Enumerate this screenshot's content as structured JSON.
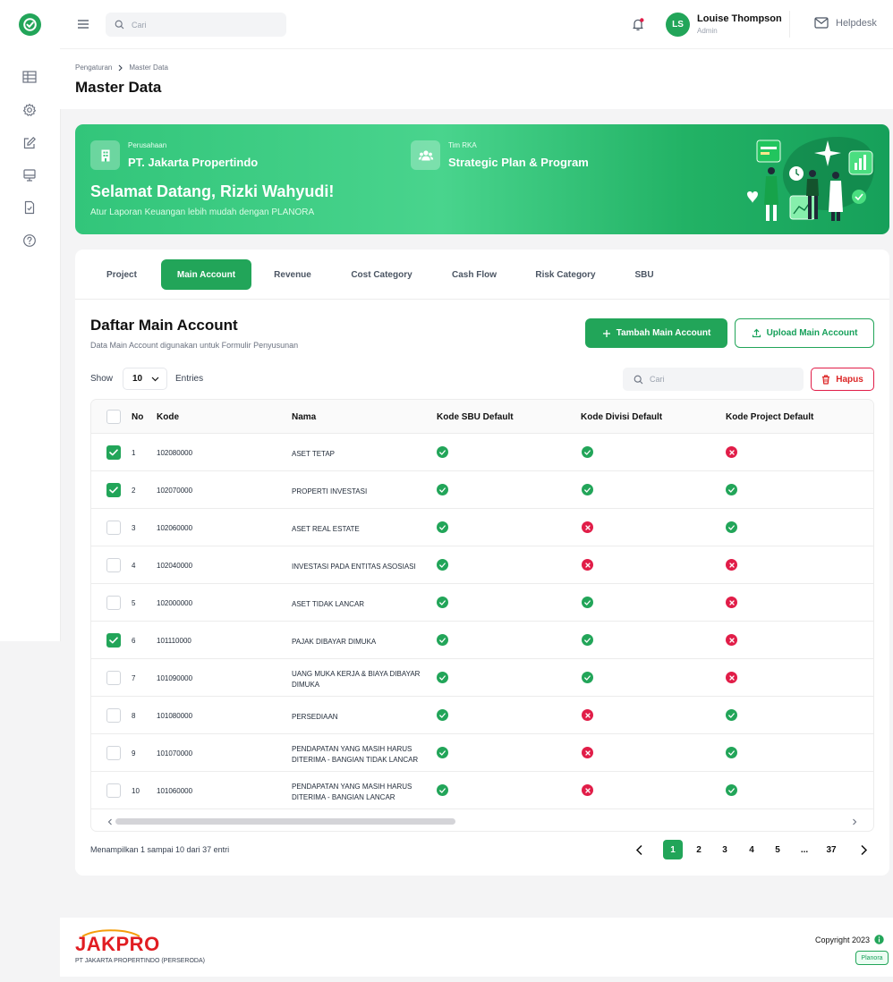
{
  "topbar": {
    "search_placeholder": "Cari",
    "user_initials": "LS",
    "user_name": "Louise Thompson",
    "user_role": "Admin",
    "helpdesk_label": "Helpdesk"
  },
  "breadcrumb": {
    "parent": "Pengaturan",
    "current": "Master Data"
  },
  "page_title": "Master Data",
  "banner": {
    "company_label": "Perusahaan",
    "company_value": "PT. Jakarta Propertindo",
    "team_label": "Tim RKA",
    "team_value": "Strategic Plan & Program",
    "welcome": "Selamat Datang, Rizki Wahyudi!",
    "subtitle": "Atur Laporan Keuangan lebih mudah dengan PLANORA"
  },
  "tabs": [
    {
      "label": "Project",
      "active": false
    },
    {
      "label": "Main Account",
      "active": true
    },
    {
      "label": "Revenue",
      "active": false
    },
    {
      "label": "Cost Category",
      "active": false
    },
    {
      "label": "Cash Flow",
      "active": false
    },
    {
      "label": "Risk Category",
      "active": false
    },
    {
      "label": "SBU",
      "active": false
    }
  ],
  "section": {
    "title": "Daftar Main Account",
    "subtitle": "Data Main Account digunakan untuk Formulir Penyusunan",
    "add_button": "Tambah Main Account",
    "upload_button": "Upload Main Account",
    "show_label": "Show",
    "entries_value": "10",
    "entries_label": "Entries",
    "search_placeholder": "Cari",
    "delete_button": "Hapus"
  },
  "table": {
    "columns": [
      "No",
      "Kode",
      "Nama",
      "Kode SBU Default",
      "Kode Divisi Default",
      "Kode Project Default"
    ],
    "rows": [
      {
        "checked": true,
        "no": "1",
        "kode": "102080000",
        "nama": [
          "ASET TETAP"
        ],
        "sbu": true,
        "divisi": true,
        "project": false
      },
      {
        "checked": true,
        "no": "2",
        "kode": "102070000",
        "nama": [
          "PROPERTI INVESTASI"
        ],
        "sbu": true,
        "divisi": true,
        "project": true
      },
      {
        "checked": false,
        "no": "3",
        "kode": "102060000",
        "nama": [
          "ASET REAL ESTATE"
        ],
        "sbu": true,
        "divisi": false,
        "project": true
      },
      {
        "checked": false,
        "no": "4",
        "kode": "102040000",
        "nama": [
          "INVESTASI PADA ENTITAS ASOSIASI"
        ],
        "sbu": true,
        "divisi": false,
        "project": false
      },
      {
        "checked": false,
        "no": "5",
        "kode": "102000000",
        "nama": [
          "ASET TIDAK LANCAR"
        ],
        "sbu": true,
        "divisi": true,
        "project": false
      },
      {
        "checked": true,
        "no": "6",
        "kode": "101110000",
        "nama": [
          "PAJAK DIBAYAR DIMUKA"
        ],
        "sbu": true,
        "divisi": true,
        "project": false
      },
      {
        "checked": false,
        "no": "7",
        "kode": "101090000",
        "nama": [
          "UANG MUKA KERJA & BIAYA DIBAYAR",
          "DIMUKA"
        ],
        "sbu": true,
        "divisi": true,
        "project": false
      },
      {
        "checked": false,
        "no": "8",
        "kode": "101080000",
        "nama": [
          "PERSEDIAAN"
        ],
        "sbu": true,
        "divisi": false,
        "project": true
      },
      {
        "checked": false,
        "no": "9",
        "kode": "101070000",
        "nama": [
          "PENDAPATAN YANG MASIH HARUS",
          "DITERIMA - BANGIAN TIDAK LANCAR"
        ],
        "sbu": true,
        "divisi": false,
        "project": true
      },
      {
        "checked": false,
        "no": "10",
        "kode": "101060000",
        "nama": [
          "PENDAPATAN YANG MASIH HARUS",
          "DITERIMA - BANGIAN LANCAR"
        ],
        "sbu": true,
        "divisi": false,
        "project": true
      }
    ]
  },
  "pagination": {
    "summary": "Menampilkan 1 sampai 10 dari 37 entri",
    "pages": [
      "1",
      "2",
      "3",
      "4",
      "5",
      "...",
      "37"
    ],
    "active": "1"
  },
  "footer": {
    "logo_text": "JAKPRO",
    "company": "PT JAKARTA PROPERTINDO (PERSERODA)",
    "copyright": "Copyright 2023",
    "badge": "Planora"
  },
  "colors": {
    "primary": "#22a559",
    "danger": "#e11d48"
  }
}
